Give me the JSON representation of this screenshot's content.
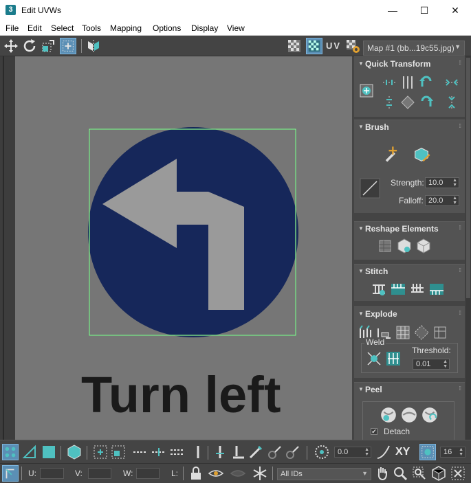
{
  "window": {
    "app_icon": "3",
    "title": "Edit UVWs",
    "minimize": "—",
    "maximize": "☐",
    "close": "✕"
  },
  "menu": [
    "File",
    "Edit",
    "Select",
    "Tools",
    "Mapping",
    "Options",
    "Display",
    "View"
  ],
  "toolbar": {
    "uv_label": "UV",
    "map_select": "Map #1 (bb...19c55.jpg)"
  },
  "viewport": {
    "texture_text": "Turn left",
    "colors": {
      "sign_blue": "#16275a",
      "background": "#767676",
      "selection_green": "#39c24a"
    }
  },
  "panel": {
    "quick_transform": {
      "title": "Quick Transform"
    },
    "brush": {
      "title": "Brush",
      "strength_label": "Strength:",
      "strength_value": "10.0",
      "falloff_label": "Falloff:",
      "falloff_value": "20.0"
    },
    "reshape": {
      "title": "Reshape Elements"
    },
    "stitch": {
      "title": "Stitch"
    },
    "explode": {
      "title": "Explode",
      "weld_label": "Weld",
      "threshold_label": "Threshold:",
      "threshold_value": "0.01"
    },
    "peel": {
      "title": "Peel",
      "detach_label": "Detach",
      "detach_checked": true
    }
  },
  "bottom": {
    "rotate_value": "0.0",
    "xy_label": "XY",
    "grid_value": "16",
    "u_label": "U:",
    "v_label": "V:",
    "w_label": "W:",
    "l_label": "L:",
    "ids_select": "All IDs"
  }
}
